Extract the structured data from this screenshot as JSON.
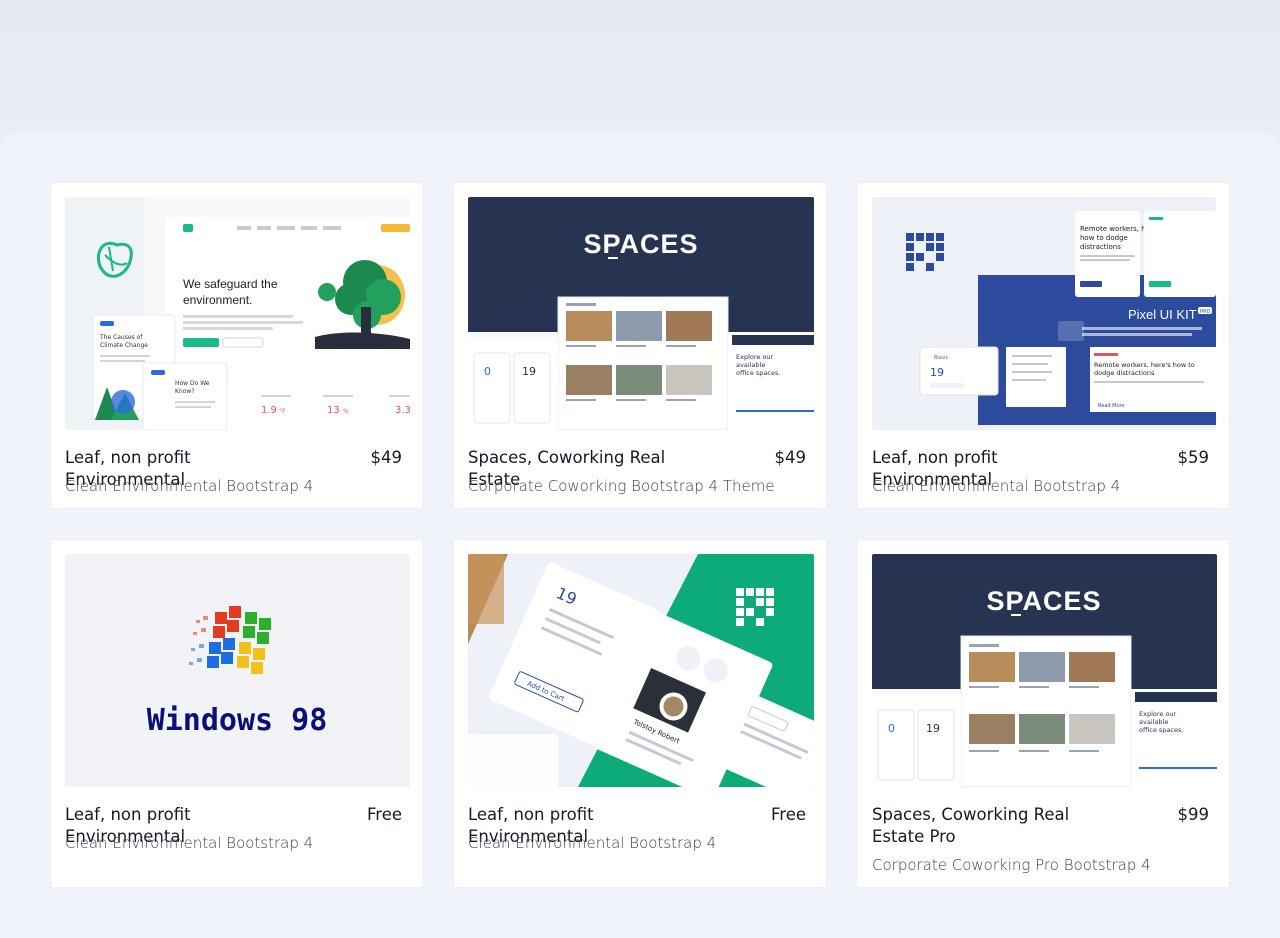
{
  "cards": [
    {
      "title": "Leaf, non profit Environmental",
      "price": "$49",
      "subtitle": "Clean Environmental Bootstrap 4",
      "thumb": {
        "kind": "leaf",
        "headline_1": "We safeguard the",
        "headline_2": "environment.",
        "card_a_1": "The Causes of",
        "card_a_2": "Climate Change",
        "card_b_1": "How Do We",
        "card_b_2": "Know?",
        "stat_1": "1.9",
        "stat_1_unit": "°F",
        "stat_2": "13",
        "stat_2_unit": "%",
        "stat_3": "3.3"
      }
    },
    {
      "title": "Spaces, Coworking Real Estate",
      "price": "$49",
      "subtitle": "Corporate Coworking Bootstrap 4 Theme",
      "thumb": {
        "kind": "spaces",
        "logo": "SPACES",
        "tagline_1": "Explore our",
        "tagline_2": "available",
        "tagline_3": "office spaces.",
        "plan_1": "0",
        "plan_2": "19"
      }
    },
    {
      "title": "Leaf, non profit Environmental",
      "price": "$59",
      "subtitle": "Clean Environmental Bootstrap 4",
      "thumb": {
        "kind": "pixel",
        "kit_title": "Pixel UI KIT",
        "badge": "PRO",
        "headline_1": "Remote workers, here's",
        "headline_2": "how to dodge",
        "headline_3": "distractions",
        "remote_1": "Remote workers, here's how to",
        "remote_2": "dodge distractions",
        "plan_label": "Basic",
        "plan_price": "19",
        "read_more": "Read More"
      }
    },
    {
      "title": "Leaf, non profit Environmental",
      "price": "Free",
      "subtitle": "Clean Environmental Bootstrap 4",
      "thumb": {
        "kind": "win98",
        "wordmark": "Windows 98"
      }
    },
    {
      "title": "Leaf, non profit Environmental",
      "price": "Free",
      "subtitle": "Clean Environmental Bootstrap 4",
      "thumb": {
        "kind": "pixelgreen",
        "price_tag": "19",
        "add_to_cart": "Add to Cart",
        "name": "Tolstoy Robert"
      }
    },
    {
      "title": "Spaces, Coworking Real Estate Pro",
      "price": "$99",
      "subtitle": "Corporate Coworking Pro Bootstrap 4",
      "thumb": {
        "kind": "spaces",
        "logo": "SPACES",
        "tagline_1": "Explore our",
        "tagline_2": "available",
        "tagline_3": "office spaces.",
        "plan_1": "0",
        "plan_2": "19"
      }
    }
  ],
  "colors": {
    "page_bg": "#e8ecf4",
    "panel_bg": "#f0f3f9",
    "card_bg": "#ffffff",
    "leaf_green": "#18b98b",
    "spaces_navy": "#273451",
    "pixel_blue": "#2c4b9c",
    "pixel_green": "#0eab7a",
    "win_navy": "#0b0f7a"
  }
}
